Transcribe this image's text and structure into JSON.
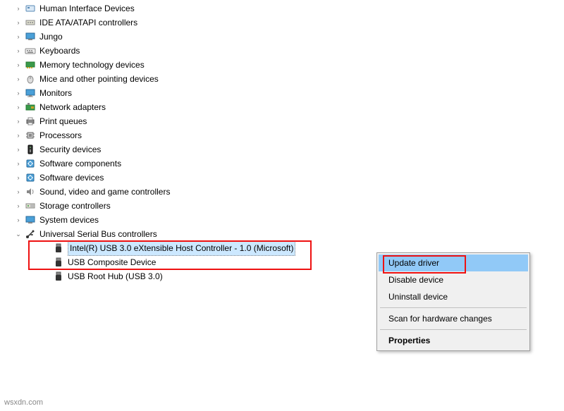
{
  "tree": {
    "categories": [
      {
        "label": "Human Interface Devices",
        "icon": "hid"
      },
      {
        "label": "IDE ATA/ATAPI controllers",
        "icon": "ide"
      },
      {
        "label": "Jungo",
        "icon": "jungo"
      },
      {
        "label": "Keyboards",
        "icon": "keyboard"
      },
      {
        "label": "Memory technology devices",
        "icon": "memory"
      },
      {
        "label": "Mice and other pointing devices",
        "icon": "mouse"
      },
      {
        "label": "Monitors",
        "icon": "monitor"
      },
      {
        "label": "Network adapters",
        "icon": "network"
      },
      {
        "label": "Print queues",
        "icon": "printer"
      },
      {
        "label": "Processors",
        "icon": "cpu"
      },
      {
        "label": "Security devices",
        "icon": "security"
      },
      {
        "label": "Software components",
        "icon": "software"
      },
      {
        "label": "Software devices",
        "icon": "software"
      },
      {
        "label": "Sound, video and game controllers",
        "icon": "sound"
      },
      {
        "label": "Storage controllers",
        "icon": "storage"
      },
      {
        "label": "System devices",
        "icon": "system"
      }
    ],
    "usb": {
      "label": "Universal Serial Bus controllers",
      "children": [
        {
          "label": "Intel(R) USB 3.0 eXtensible Host Controller - 1.0 (Microsoft)",
          "selected": true
        },
        {
          "label": "USB Composite Device",
          "selected": false
        },
        {
          "label": "USB Root Hub (USB 3.0)",
          "selected": false
        }
      ]
    }
  },
  "context_menu": {
    "update": "Update driver",
    "disable": "Disable device",
    "uninstall": "Uninstall device",
    "scan": "Scan for hardware changes",
    "properties": "Properties"
  },
  "watermark": "wsxdn.com"
}
